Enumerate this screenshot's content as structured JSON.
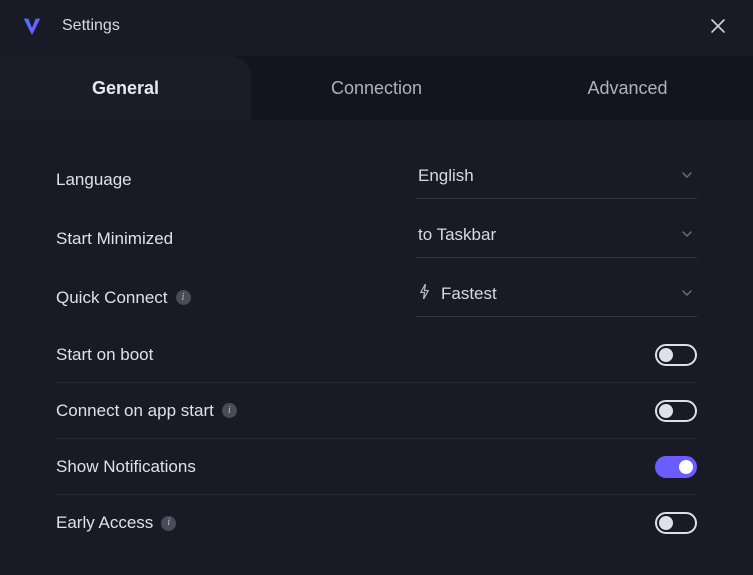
{
  "titlebar": {
    "title": "Settings"
  },
  "tabs": {
    "general": "General",
    "connection": "Connection",
    "advanced": "Advanced",
    "active": "general"
  },
  "settings": {
    "language": {
      "label": "Language",
      "value": "English"
    },
    "start_minimized": {
      "label": "Start Minimized",
      "value": "to Taskbar"
    },
    "quick_connect": {
      "label": "Quick Connect",
      "value": "Fastest"
    },
    "start_on_boot": {
      "label": "Start on boot",
      "on": false
    },
    "connect_on_start": {
      "label": "Connect on app start",
      "on": false
    },
    "show_notifications": {
      "label": "Show Notifications",
      "on": true
    },
    "early_access": {
      "label": "Early Access",
      "on": false
    }
  },
  "icons": {
    "app_logo": "app-logo",
    "close": "close-icon",
    "info": "info-icon",
    "chevron_down": "chevron-down-icon",
    "bolt": "bolt-icon"
  }
}
